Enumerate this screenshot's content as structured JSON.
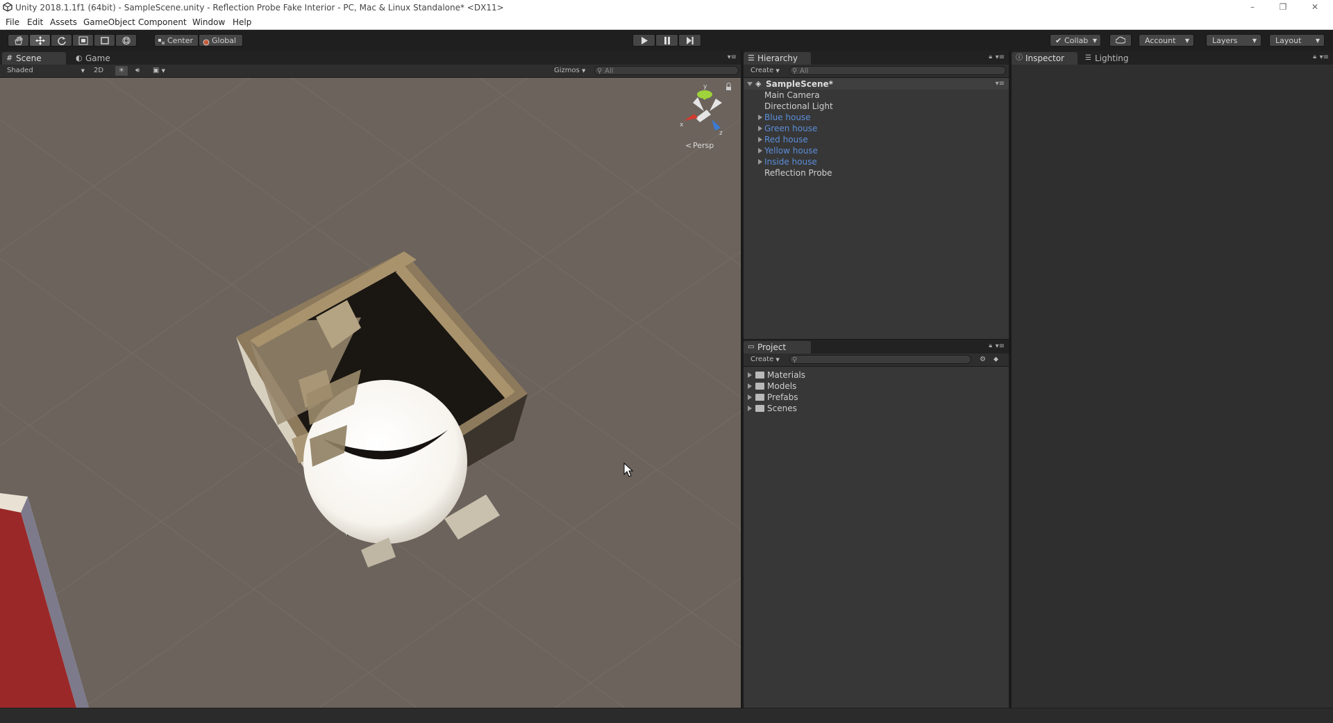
{
  "window": {
    "title": "Unity 2018.1.1f1 (64bit) - SampleScene.unity - Reflection Probe Fake Interior - PC, Mac & Linux Standalone* <DX11>",
    "minimize": "–",
    "restore": "❐",
    "close": "✕"
  },
  "menu": [
    "File",
    "Edit",
    "Assets",
    "GameObject",
    "Component",
    "Window",
    "Help"
  ],
  "toolbar": {
    "pivot": "Center",
    "space": "Global",
    "collab": "Collab",
    "account": "Account",
    "layers": "Layers",
    "layout": "Layout"
  },
  "scene_panel": {
    "tabs": [
      "Scene",
      "Game"
    ],
    "shading": "Shaded",
    "mode_2d": "2D",
    "gizmos": "Gizmos",
    "search_placeholder": "All",
    "projection": "Persp",
    "axis_labels": [
      "y",
      "x",
      "z"
    ]
  },
  "hierarchy": {
    "tab": "Hierarchy",
    "create": "Create",
    "search_placeholder": "All",
    "scene_name": "SampleScene*",
    "items": [
      {
        "label": "Main Camera",
        "prefab": false,
        "expandable": false
      },
      {
        "label": "Directional Light",
        "prefab": false,
        "expandable": false
      },
      {
        "label": "Blue house",
        "prefab": true,
        "expandable": true
      },
      {
        "label": "Green house",
        "prefab": true,
        "expandable": true
      },
      {
        "label": "Red house",
        "prefab": true,
        "expandable": true
      },
      {
        "label": "Yellow house",
        "prefab": true,
        "expandable": true
      },
      {
        "label": "Inside house",
        "prefab": true,
        "expandable": true
      },
      {
        "label": "Reflection Probe",
        "prefab": false,
        "expandable": false
      }
    ]
  },
  "project": {
    "tab": "Project",
    "create": "Create",
    "folders": [
      "Materials",
      "Models",
      "Prefabs",
      "Scenes"
    ]
  },
  "inspector": {
    "tabs": [
      "Inspector",
      "Lighting"
    ]
  },
  "colors": {
    "prefab_text": "#5c8ed9",
    "scene_ground": "#6b635c",
    "panel_bg": "#373737"
  }
}
